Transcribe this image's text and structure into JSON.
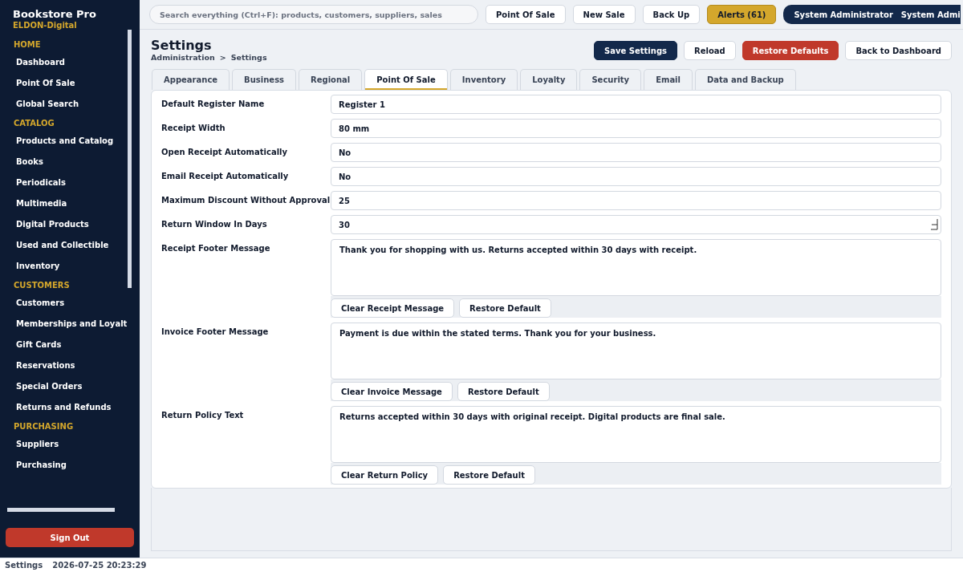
{
  "app": {
    "title": "Bookstore Pro",
    "subtitle": "ELDON-Digital"
  },
  "sidebar": {
    "sections": [
      {
        "heading": "HOME",
        "items": [
          {
            "label": "Dashboard",
            "selected": false
          },
          {
            "label": "Point Of Sale",
            "selected": false
          },
          {
            "label": "Global Search",
            "selected": false
          }
        ]
      },
      {
        "heading": "CATALOG",
        "items": [
          {
            "label": "Products and Catalog",
            "selected": false
          },
          {
            "label": "Books",
            "selected": false
          },
          {
            "label": "Periodicals",
            "selected": false
          },
          {
            "label": "Multimedia",
            "selected": false
          },
          {
            "label": "Digital Products",
            "selected": false
          },
          {
            "label": "Used and Collectible",
            "selected": false
          },
          {
            "label": "Inventory",
            "selected": false
          }
        ]
      },
      {
        "heading": "CUSTOMERS",
        "items": [
          {
            "label": "Customers",
            "selected": false
          },
          {
            "label": "Memberships and Loyalt",
            "selected": false
          },
          {
            "label": "Gift Cards",
            "selected": false
          },
          {
            "label": "Reservations",
            "selected": false
          },
          {
            "label": "Special Orders",
            "selected": false
          },
          {
            "label": "Returns and Refunds",
            "selected": false
          }
        ]
      },
      {
        "heading": "PURCHASING",
        "items": [
          {
            "label": "Suppliers",
            "selected": false
          },
          {
            "label": "Purchasing",
            "selected": false
          }
        ]
      }
    ],
    "sign_out": "Sign Out"
  },
  "topbar": {
    "search": {
      "placeholder": "Search everything (Ctrl+F): products, customers, suppliers, sales"
    },
    "buttons": [
      {
        "label": "Point Of Sale",
        "kind": "plain"
      },
      {
        "label": "New Sale",
        "kind": "plain"
      },
      {
        "label": "Back Up",
        "kind": "plain"
      },
      {
        "label": "Alerts (61)",
        "kind": "alert"
      }
    ],
    "user": {
      "name": "System Administrator",
      "role": "System Admi"
    }
  },
  "page": {
    "title": "Settings",
    "breadcrumb": [
      "Administration",
      ">",
      "Settings"
    ],
    "actions": [
      {
        "label": "Save Settings",
        "kind": "primary"
      },
      {
        "label": "Reload",
        "kind": "plain"
      },
      {
        "label": "Restore Defaults",
        "kind": "danger"
      },
      {
        "label": "Back to Dashboard",
        "kind": "plain"
      }
    ]
  },
  "tabs": [
    {
      "label": "Appearance",
      "selected": false
    },
    {
      "label": "Business",
      "selected": false
    },
    {
      "label": "Regional",
      "selected": false
    },
    {
      "label": "Point Of Sale",
      "selected": true
    },
    {
      "label": "Inventory",
      "selected": false
    },
    {
      "label": "Loyalty",
      "selected": false
    },
    {
      "label": "Security",
      "selected": false
    },
    {
      "label": "Email",
      "selected": false
    },
    {
      "label": "Data and Backup",
      "selected": false
    }
  ],
  "fields": [
    {
      "kind": "text",
      "label": "Default Register Name",
      "value": "Register 1"
    },
    {
      "kind": "text",
      "label": "Receipt Width",
      "value": "80 mm"
    },
    {
      "kind": "text",
      "label": "Open Receipt Automatically",
      "value": "No"
    },
    {
      "kind": "text",
      "label": "Email Receipt Automatically",
      "value": "No"
    },
    {
      "kind": "text",
      "label": "Maximum Discount Without Approval",
      "value": "25"
    },
    {
      "kind": "number",
      "label": "Return Window In Days",
      "value": "30"
    },
    {
      "kind": "message",
      "label": "Receipt Footer Message",
      "value": "Thank you for shopping with us. Returns accepted within 30 days with receipt.",
      "buttons": [
        "Clear Receipt Message",
        "Restore Default"
      ]
    },
    {
      "kind": "message",
      "label": "Invoice Footer Message",
      "value": "Payment is due within the stated terms. Thank you for your business.",
      "buttons": [
        "Clear Invoice Message",
        "Restore Default"
      ]
    },
    {
      "kind": "message",
      "label": "Return Policy Text",
      "value": "Returns accepted within 30 days with original receipt. Digital products are final sale.",
      "buttons": [
        "Clear Return Policy",
        "Restore Default"
      ]
    }
  ],
  "status_bar": {
    "page": "Settings",
    "time": "2026-07-25 20:23:29"
  }
}
